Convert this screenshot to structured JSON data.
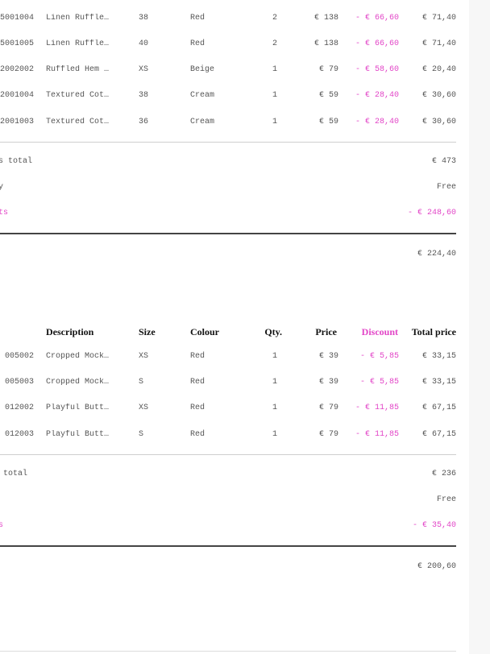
{
  "colors": {
    "discount": "#e245c7",
    "text": "#555555",
    "header": "#111111"
  },
  "order1": {
    "rows": [
      {
        "code": "5001004",
        "desc": "Linen Ruffle…",
        "size": "38",
        "colour": "Red",
        "qty": "2",
        "price": "€ 138",
        "discount": "- € 66,60",
        "total": "€ 71,40"
      },
      {
        "code": "5001005",
        "desc": "Linen Ruffle…",
        "size": "40",
        "colour": "Red",
        "qty": "2",
        "price": "€ 138",
        "discount": "- € 66,60",
        "total": "€ 71,40"
      },
      {
        "code": "2002002",
        "desc": "Ruffled Hem …",
        "size": "XS",
        "colour": "Beige",
        "qty": "1",
        "price": "€ 79",
        "discount": "- € 58,60",
        "total": "€ 20,40"
      },
      {
        "code": "2001004",
        "desc": "Textured Cot…",
        "size": "38",
        "colour": "Cream",
        "qty": "1",
        "price": "€ 59",
        "discount": "- € 28,40",
        "total": "€ 30,60"
      },
      {
        "code": "2001003",
        "desc": "Textured Cot…",
        "size": "36",
        "colour": "Cream",
        "qty": "1",
        "price": "€ 59",
        "discount": "- € 28,40",
        "total": "€ 30,60"
      }
    ],
    "items_total_label": "ts total",
    "items_total_value": "€ 473",
    "delivery_label": "ry",
    "delivery_value": "Free",
    "discounts_label": "nts",
    "discounts_value": "- € 248,60",
    "grand_total": "€ 224,40"
  },
  "order2": {
    "header": {
      "description": "Description",
      "size": "Size",
      "colour": "Colour",
      "qty": "Qty.",
      "price": "Price",
      "discount": "Discount",
      "total": "Total price"
    },
    "rows": [
      {
        "code": "005002",
        "desc": "Cropped Mock…",
        "size": "XS",
        "colour": "Red",
        "qty": "1",
        "price": "€ 39",
        "discount": "- € 5,85",
        "total": "€ 33,15"
      },
      {
        "code": "005003",
        "desc": "Cropped Mock…",
        "size": "S",
        "colour": "Red",
        "qty": "1",
        "price": "€ 39",
        "discount": "- € 5,85",
        "total": "€ 33,15"
      },
      {
        "code": "012002",
        "desc": "Playful Butt…",
        "size": "XS",
        "colour": "Red",
        "qty": "1",
        "price": "€ 79",
        "discount": "- € 11,85",
        "total": "€ 67,15"
      },
      {
        "code": "012003",
        "desc": "Playful Butt…",
        "size": "S",
        "colour": "Red",
        "qty": "1",
        "price": "€ 79",
        "discount": "- € 11,85",
        "total": "€ 67,15"
      }
    ],
    "items_total_label": "s total",
    "items_total_value": "€ 236",
    "delivery_label": "y",
    "delivery_value": "Free",
    "discounts_label": "ts",
    "discounts_value": "- € 35,40",
    "grand_total": "€ 200,60"
  }
}
